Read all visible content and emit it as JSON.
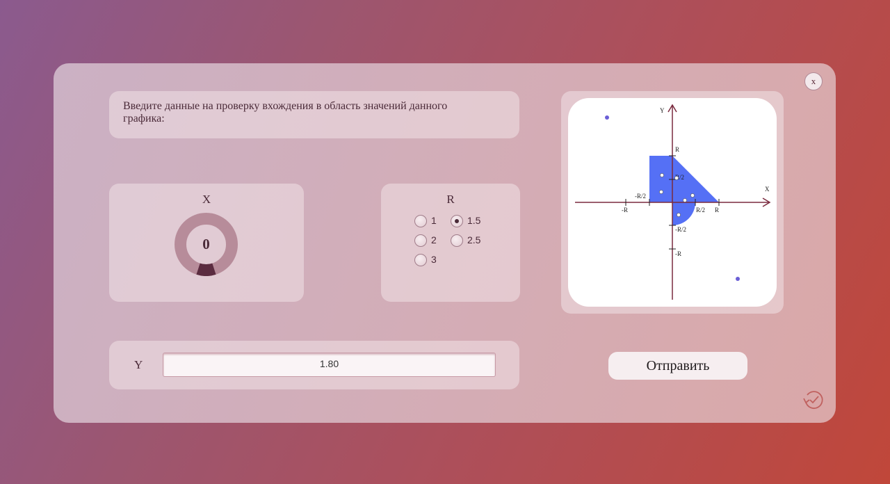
{
  "close_label": "x",
  "instruction": "Введите данные на проверку вхождения в область значений данного графика:",
  "x_block": {
    "title": "X",
    "value": "0",
    "knob_level": 0.1
  },
  "r_block": {
    "title": "R",
    "options": [
      "1",
      "1.5",
      "2",
      "2.5",
      "3"
    ],
    "selected": "1.5"
  },
  "y_block": {
    "label": "Y",
    "value": "1.80"
  },
  "graph": {
    "x_axis_label": "X",
    "y_axis_label": "Y",
    "ticks": {
      "x_neg_r": "-R",
      "x_neg_half": "-R/2",
      "x_half": "R/2",
      "x_r": "R",
      "y_r": "R",
      "y_half": "R/2",
      "y_neg_half": "-R/2",
      "y_neg_r": "-R"
    },
    "area_color": "#5570f5",
    "point_color": "#6b5fd6"
  },
  "submit_label": "Отправить",
  "history_icon": "history-clock-icon"
}
